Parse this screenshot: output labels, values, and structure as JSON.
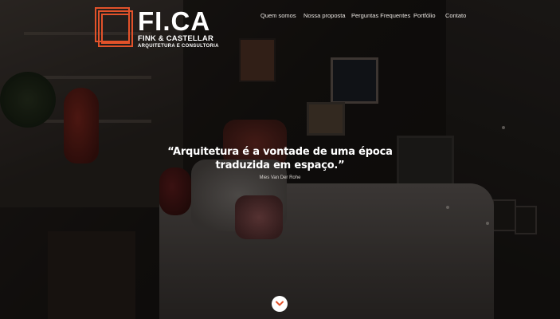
{
  "brand": {
    "name": "FI.CA",
    "line1": "FINK & CASTELLAR",
    "line2": "ARQUITETURA E CONSULTORIA",
    "accent_color": "#e2522a"
  },
  "nav": {
    "items": [
      {
        "label": "Quem somos"
      },
      {
        "label": "Nossa proposta"
      },
      {
        "label": "Perguntas Frequentes"
      },
      {
        "label": "Portfólio"
      },
      {
        "label": "Contato"
      }
    ]
  },
  "hero": {
    "quote_line1": "“Arquitetura é a vontade de uma época",
    "quote_line2": "traduzida em espaço.”",
    "author": "Mies Van Der Rohe"
  },
  "scroll": {
    "icon": "chevron-down-icon",
    "color": "#e2522a"
  }
}
